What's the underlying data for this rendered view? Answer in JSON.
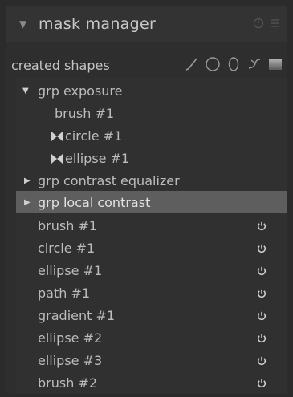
{
  "header": {
    "title": "mask manager",
    "collapse_icon": "triangle-down-icon",
    "reset_icon": "reset-icon",
    "presets_icon": "hamburger-menu-icon"
  },
  "toolbar": {
    "label": "created shapes",
    "tools": [
      "brush-icon",
      "circle-icon",
      "ellipse-icon",
      "path-icon",
      "gradient-icon"
    ]
  },
  "groups": [
    {
      "label": "grp exposure",
      "expanded": true,
      "children": [
        {
          "label": "brush #1",
          "icon": ""
        },
        {
          "label": "circle #1",
          "icon": "inverted-icon"
        },
        {
          "label": "ellipse #1",
          "icon": "inverted-icon"
        }
      ]
    },
    {
      "label": "grp contrast equalizer",
      "expanded": false
    },
    {
      "label": "grp local contrast",
      "expanded": false,
      "selected": true
    }
  ],
  "shapes": [
    {
      "label": "brush #1"
    },
    {
      "label": "circle #1"
    },
    {
      "label": "ellipse #1"
    },
    {
      "label": "path #1"
    },
    {
      "label": "gradient #1"
    },
    {
      "label": "ellipse #2"
    },
    {
      "label": "ellipse #3"
    },
    {
      "label": "brush #2"
    }
  ],
  "colors": {
    "selected_row": "#5e5e5e",
    "panel": "#2e2e2e"
  }
}
